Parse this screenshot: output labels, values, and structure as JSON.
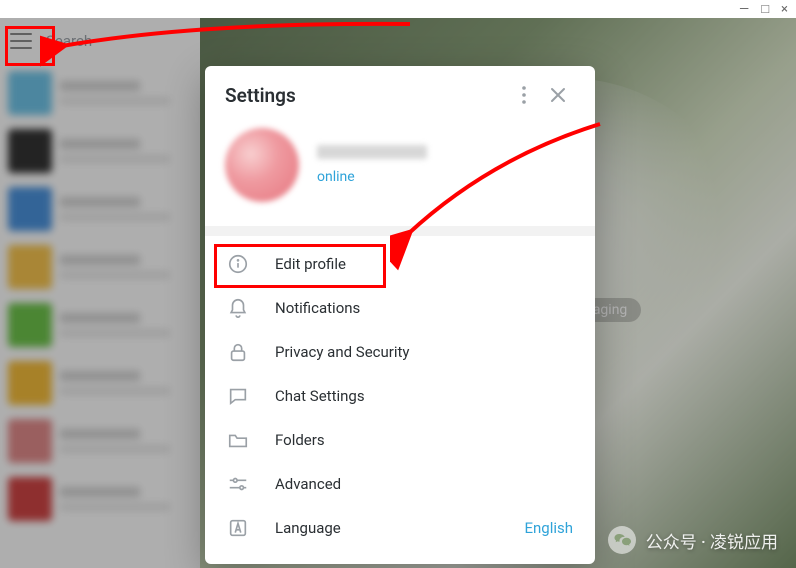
{
  "window": {
    "minimize": "—",
    "maximize": "□",
    "close": "×"
  },
  "sidebar": {
    "search_placeholder": "Search"
  },
  "main": {
    "background_label": "…ssaging"
  },
  "settings": {
    "title": "Settings",
    "status": "online",
    "menu": {
      "edit_profile": "Edit profile",
      "notifications": "Notifications",
      "privacy": "Privacy and Security",
      "chat": "Chat Settings",
      "folders": "Folders",
      "advanced": "Advanced",
      "language": "Language",
      "language_value": "English"
    }
  },
  "watermark": {
    "text": "公众号 · 凌锐应用"
  }
}
